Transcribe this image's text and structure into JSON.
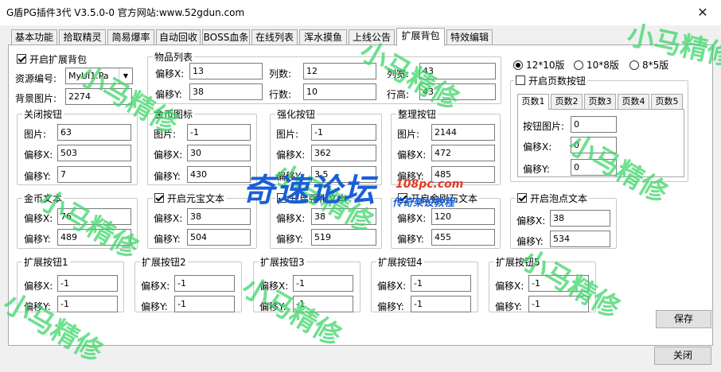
{
  "window": {
    "title": "G盾PG插件3代 V3.5.0-0   官方网站:www.52gdun.com",
    "close_glyph": "✕"
  },
  "tabs": [
    "基本功能",
    "拾取精灵",
    "简易爆率",
    "自动回收",
    "BOSS血条",
    "在线列表",
    "浑水摸鱼",
    "上线公告",
    "扩展背包",
    "特效编辑"
  ],
  "active_tab": "扩展背包",
  "enable_bag": {
    "label": "开启扩展背包",
    "checked": true
  },
  "resource": {
    "label": "资源编号:",
    "value": "MyUI1.Pa"
  },
  "bg_image": {
    "label": "背景图片:",
    "value": "2274"
  },
  "item_list": {
    "title": "物品列表",
    "offset_x": {
      "label": "偏移X:",
      "value": "13"
    },
    "offset_y": {
      "label": "偏移Y:",
      "value": "38"
    },
    "cols": {
      "label": "列数:",
      "value": "12"
    },
    "rows": {
      "label": "行数:",
      "value": "10"
    },
    "col_width": {
      "label": "列宽:",
      "value": "43"
    },
    "row_height": {
      "label": "行高:",
      "value": "43"
    }
  },
  "btn_groups": [
    {
      "title": "关闭按钮",
      "img_label": "图片:",
      "img": "63",
      "x_label": "偏移X:",
      "x": "503",
      "y_label": "偏移Y:",
      "y": "7"
    },
    {
      "title": "金币图标",
      "img_label": "图片:",
      "img": "-1",
      "x_label": "偏移X:",
      "x": "30",
      "y_label": "偏移Y:",
      "y": "430"
    },
    {
      "title": "强化按钮",
      "img_label": "图片:",
      "img": "-1",
      "x_label": "偏移X:",
      "x": "362",
      "y_label": "偏移Y:",
      "y": "3.5"
    },
    {
      "title": "整理按钮",
      "img_label": "图片:",
      "img": "2144",
      "x_label": "偏移X:",
      "x": "472",
      "y_label": "偏移Y:",
      "y": "485"
    }
  ],
  "text_groups": [
    {
      "title": "金币文本",
      "has_checkbox": false,
      "checked": false,
      "x_label": "偏移X:",
      "x": "76",
      "y_label": "偏移Y:",
      "y": "489"
    },
    {
      "title": "开启元宝文本",
      "has_checkbox": true,
      "checked": true,
      "x_label": "偏移X:",
      "x": "38",
      "y_label": "偏移Y:",
      "y": "504"
    },
    {
      "title": "开启强化文本",
      "has_checkbox": true,
      "checked": true,
      "x_label": "偏移X:",
      "x": "38",
      "y_label": "偏移Y:",
      "y": "519"
    },
    {
      "title": "开启金刚石文本",
      "has_checkbox": true,
      "checked": true,
      "x_label": "偏移X:",
      "x": "120",
      "y_label": "偏移Y:",
      "y": "455"
    },
    {
      "title": "开启泡点文本",
      "has_checkbox": true,
      "checked": true,
      "x_label": "偏移X:",
      "x": "38",
      "y_label": "偏移Y:",
      "y": "534"
    }
  ],
  "ext_buttons": [
    {
      "title": "扩展按钮1",
      "x_label": "偏移X:",
      "x": "-1",
      "y_label": "偏移Y:",
      "y": "-1"
    },
    {
      "title": "扩展按钮2",
      "x_label": "偏移X:",
      "x": "-1",
      "y_label": "偏移Y:",
      "y": "-1"
    },
    {
      "title": "扩展按钮3",
      "x_label": "偏移X:",
      "x": "-1",
      "y_label": "偏移Y:",
      "y": "-1"
    },
    {
      "title": "扩展按钮4",
      "x_label": "偏移X:",
      "x": "-1",
      "y_label": "偏移Y:",
      "y": "-1"
    },
    {
      "title": "扩展按钮5",
      "x_label": "偏移X:",
      "x": "-1",
      "y_label": "偏移Y:",
      "y": "-1"
    }
  ],
  "layout_options": [
    {
      "label": "12*10版",
      "checked": true
    },
    {
      "label": "10*8版",
      "checked": false
    },
    {
      "label": "8*5版",
      "checked": false
    }
  ],
  "page_buttons": {
    "title": "开启页数按钮",
    "checked": false,
    "tabs": [
      "页数1",
      "页数2",
      "页数3",
      "页数4",
      "页数5"
    ],
    "img_label": "按钮图片:",
    "img": "0",
    "x_label": "偏移X:",
    "x": "0",
    "y_label": "偏移Y:",
    "y": "0"
  },
  "save_label": "保存",
  "close_label": "关闭",
  "watermark": {
    "text": "小马精修"
  },
  "logo": {
    "main": "奇速论坛",
    "url": "108pc.com",
    "sub": "传奇架设教程"
  }
}
